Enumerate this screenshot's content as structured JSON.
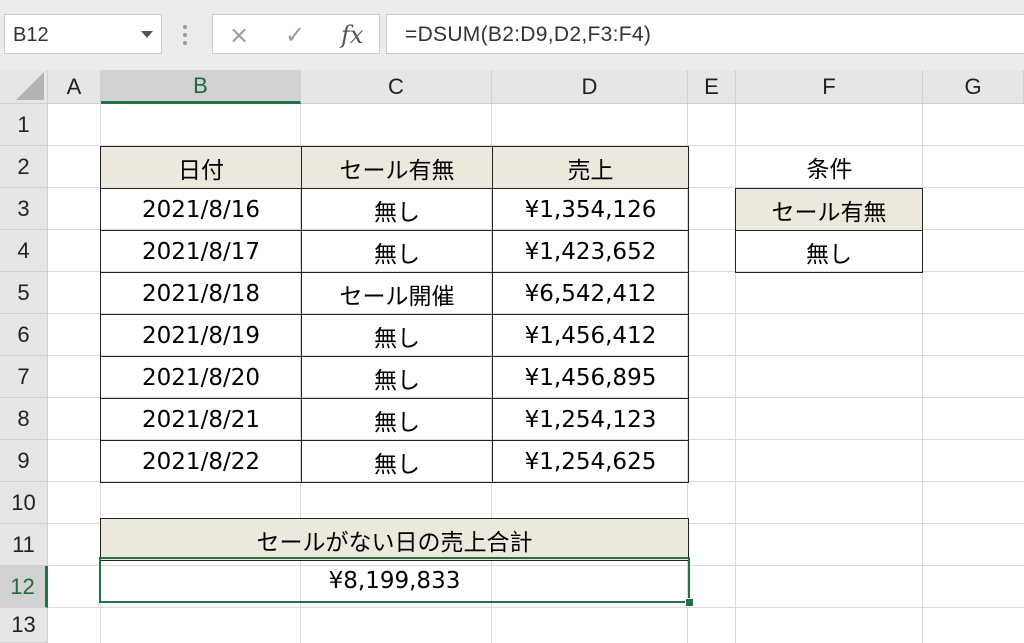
{
  "formula_bar": {
    "name_box": "B12",
    "cancel_icon": "×",
    "enter_icon": "✓",
    "fx_label": "fx",
    "formula": "=DSUM(B2:D9,D2,F3:F4)"
  },
  "columns": [
    "A",
    "B",
    "C",
    "D",
    "E",
    "F",
    "G"
  ],
  "rows": [
    "1",
    "2",
    "3",
    "4",
    "5",
    "6",
    "7",
    "8",
    "9",
    "10",
    "11",
    "12",
    "13"
  ],
  "selected": {
    "column": "B",
    "row": "12"
  },
  "table": {
    "headers": [
      "日付",
      "セール有無",
      "売上"
    ],
    "rows": [
      [
        "2021/8/16",
        "無し",
        "¥1,354,126"
      ],
      [
        "2021/8/17",
        "無し",
        "¥1,423,652"
      ],
      [
        "2021/8/18",
        "セール開催",
        "¥6,542,412"
      ],
      [
        "2021/8/19",
        "無し",
        "¥1,456,412"
      ],
      [
        "2021/8/20",
        "無し",
        "¥1,456,895"
      ],
      [
        "2021/8/21",
        "無し",
        "¥1,254,123"
      ],
      [
        "2021/8/22",
        "無し",
        "¥1,254,625"
      ]
    ]
  },
  "criteria": {
    "label": "条件",
    "header": "セール有無",
    "value": "無し"
  },
  "summary": {
    "label": "セールがない日の売上合計",
    "value": "¥8,199,833"
  },
  "colors": {
    "accent": "#217346",
    "header_fill": "#ede8dc"
  }
}
